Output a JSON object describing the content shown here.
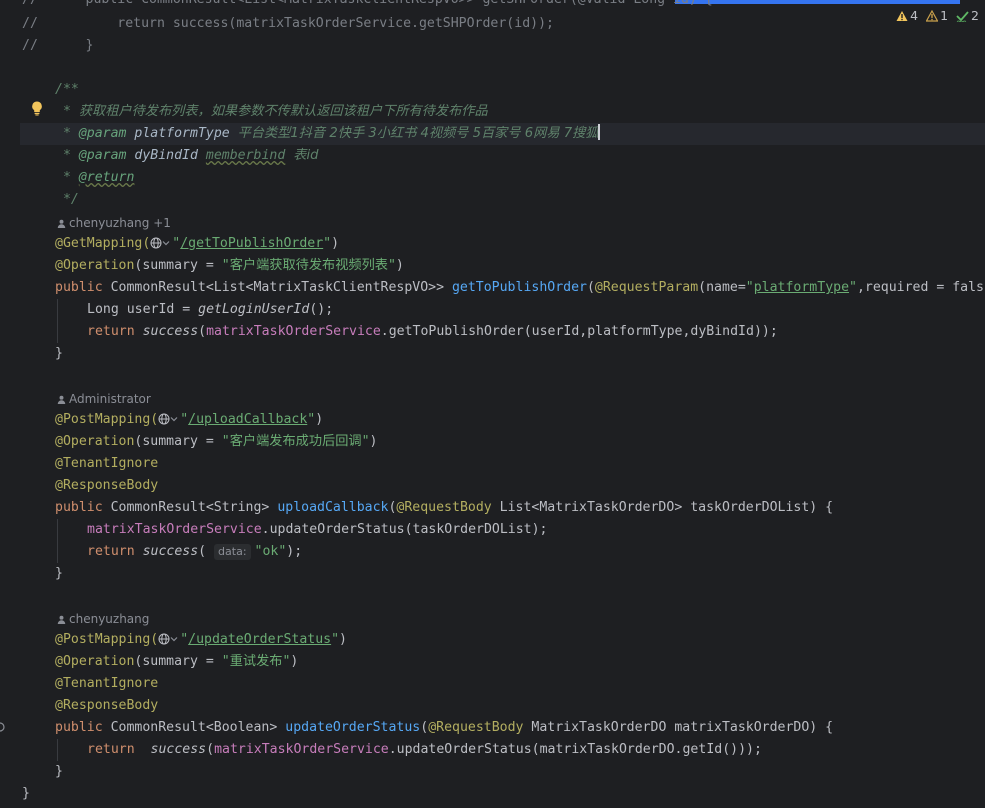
{
  "inspections": {
    "errors": "4",
    "warnings": "1",
    "ok": "2",
    "error_color": "#f2c55c",
    "ok_color": "#5fb865"
  },
  "code": {
    "l1": {
      "a": "//      public CommonResult<List<MatrixTaskClientRespVO>> getSHPOrder(@Valid Long id) {"
    },
    "l2": {
      "a": "//          return success(matrixTaskOrderService.getSHPOrder(id));"
    },
    "l3": {
      "a": "//      }"
    },
    "doc_open": "/**",
    "doc_desc_star": " * ",
    "doc_desc": "获取租户待发布列表，如果参数不传默认返回该租户下所有待发布作品",
    "doc_p1_tag": "@param",
    "doc_p1_name": "platformType",
    "doc_p1_desc": "平台类型1抖音 2快手 3小红书 4视频号 5百家号 6网易 7搜狐",
    "doc_p2_tag": "@param",
    "doc_p2_name": "dyBindId",
    "doc_p2_link": "memberbind",
    "doc_p2_desc": "表id",
    "doc_return": "@return",
    "doc_close": " */",
    "author1": "chenyuzhang +1",
    "m1": {
      "ann": "@GetMapping(",
      "path": "/getToPublishOrder",
      "op_ann": "@Operation",
      "op_pre": "(summary = ",
      "op_str": "\"客户端获取待发布视频列表\"",
      "public": "public ",
      "ret": "CommonResult<List<MatrixTaskClientRespVO>> ",
      "name": "getToPublishOrder",
      "param_ann": "@RequestParam",
      "param_pre": "(name=",
      "param_val": "platformType",
      "param_post": ",required = fals",
      "body1_type": "Long userId = ",
      "body1_call": "getLoginUserId",
      "body1_end": "();",
      "body2_kw": "return ",
      "body2_call": "success",
      "body2_field": "matrixTaskOrderService",
      "body2_rest": ".getToPublishOrder(userId,platformType,dyBindId));"
    },
    "author2": "Administrator",
    "m2": {
      "ann": "@PostMapping(",
      "path": "/uploadCallback",
      "op_ann": "@Operation",
      "op_pre": "(summary = ",
      "op_str": "\"客户端发布成功后回调\"",
      "ann3": "@TenantIgnore",
      "ann4": "@ResponseBody",
      "public": "public ",
      "ret": "CommonResult<String> ",
      "name": "uploadCallback",
      "param_ann": "@RequestBody",
      "param_rest": " List<MatrixTaskOrderDO> taskOrderDOList) {",
      "body1_field": "matrixTaskOrderService",
      "body1_rest": ".updateOrderStatus(taskOrderDOList);",
      "body2_kw": "return ",
      "body2_call": "success",
      "hint": "data:",
      "body2_str": "\"ok\"",
      "body2_end": ");"
    },
    "author3": "chenyuzhang",
    "m3": {
      "ann": "@PostMapping(",
      "path": "/updateOrderStatus",
      "op_ann": "@Operation",
      "op_pre": "(summary = ",
      "op_str": "\"重试发布\"",
      "ann3": "@TenantIgnore",
      "ann4": "@ResponseBody",
      "public": "public ",
      "ret": "CommonResult<Boolean> ",
      "name": "updateOrderStatus",
      "param_ann": "@RequestBody",
      "param_rest": " MatrixTaskOrderDO matrixTaskOrderDO) {",
      "body_kw": "return  ",
      "body_call": "success",
      "body_field": "matrixTaskOrderService",
      "body_rest": ".updateOrderStatus(matrixTaskOrderDO.getId()));"
    }
  }
}
